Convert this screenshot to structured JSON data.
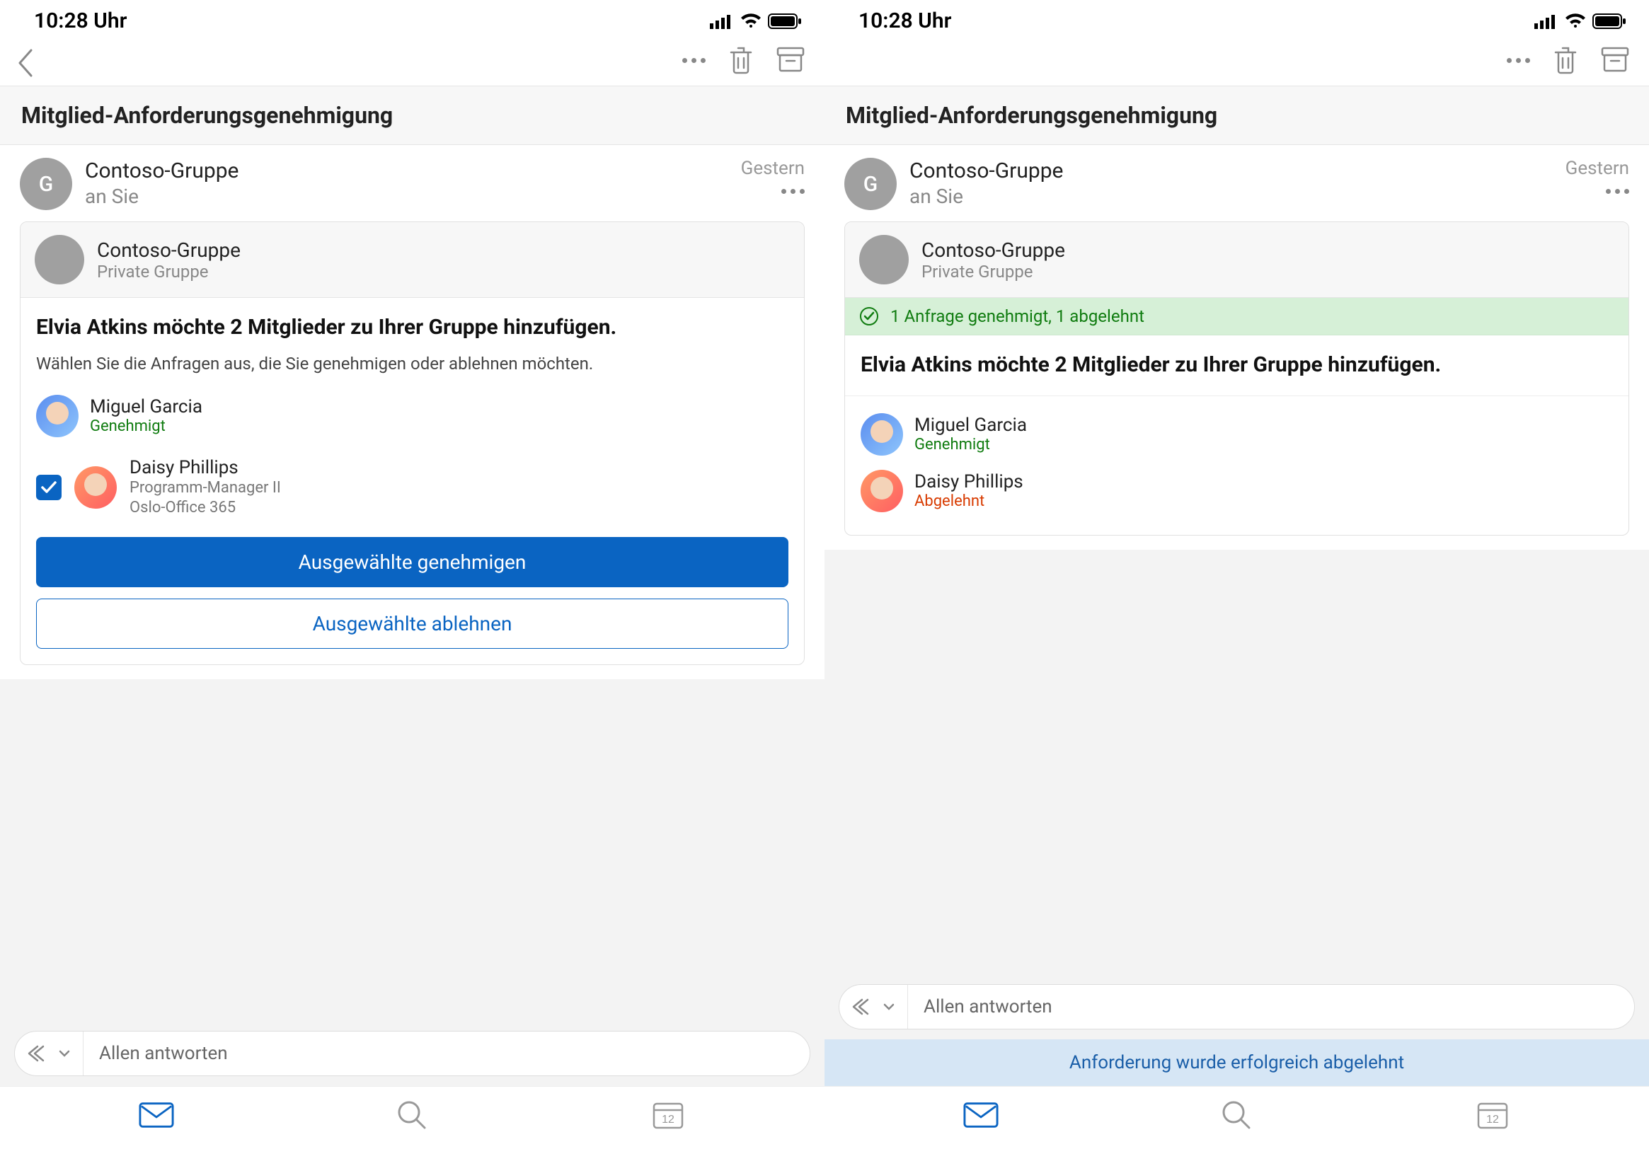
{
  "status": {
    "time": "10:28 Uhr"
  },
  "subject": "Mitglied-Anforderungsgenehmigung",
  "sender": {
    "avatar_letter": "G",
    "name": "Contoso-Gruppe",
    "to": "an Sie",
    "date": "Gestern"
  },
  "group": {
    "name": "Contoso-Gruppe",
    "type": "Private Gruppe"
  },
  "request": {
    "title": "Elvia Atkins möchte 2 Mitglieder zu Ihrer Gruppe hinzufügen.",
    "hint": "Wählen Sie die Anfragen aus, die Sie genehmigen oder ablehnen möchten."
  },
  "members": {
    "p1": {
      "name": "Miguel Garcia",
      "status_approved": "Genehmigt"
    },
    "p2": {
      "name": "Daisy Phillips",
      "role": "Programm-Manager II",
      "org": "Oslo-Office 365",
      "status_rejected": "Abgelehnt"
    }
  },
  "buttons": {
    "approve": "Ausgewählte genehmigen",
    "reject": "Ausgewählte ablehnen"
  },
  "banner": "1 Anfrage genehmigt, 1 abgelehnt",
  "reply": {
    "label": "Allen antworten"
  },
  "toast": "Anforderung wurde erfolgreich abgelehnt",
  "tabbar": {
    "calendar_day": "12"
  }
}
